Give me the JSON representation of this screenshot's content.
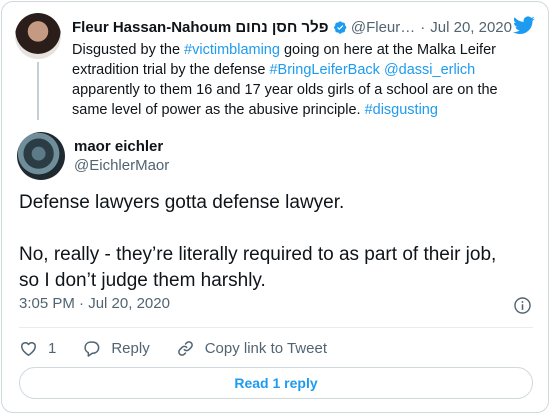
{
  "parent_tweet": {
    "author_name": "Fleur Hassan-Nahoum פלר חסן נחום",
    "handle": "@Fleur…",
    "date": "Jul 20, 2020",
    "text_lines": [
      [
        {
          "t": "Disgusted by the "
        },
        {
          "t": "#victimblaming",
          "link": true
        },
        {
          "t": " going on here at the Malka Leifer"
        }
      ],
      [
        {
          "t": "extradition trial by the defense "
        },
        {
          "t": "#BringLeiferBack",
          "link": true
        },
        {
          "t": " "
        },
        {
          "t": "@dassi_erlich",
          "link": true
        }
      ],
      [
        {
          "t": "apparently to them 16 and 17 year olds girls of a school are on the"
        }
      ],
      [
        {
          "t": "same level of power as the abusive principle. "
        },
        {
          "t": "#disgusting",
          "link": true
        }
      ]
    ]
  },
  "reply_tweet": {
    "author_name": "maor eichler",
    "handle": "@EichlerMaor",
    "text_lines": [
      "Defense lawyers gotta defense lawyer.",
      "",
      "No, really - they’re literally required to as part of their job,",
      "so I don’t judge them harshly."
    ],
    "time": "3:05 PM",
    "date": "Jul 20, 2020"
  },
  "actions": {
    "like_count": "1",
    "reply_label": "Reply",
    "copy_link_label": "Copy link to Tweet"
  },
  "read_replies_label": "Read 1 reply",
  "colors": {
    "link": "#1d9bf0",
    "text": "#0f1419",
    "muted": "#536471",
    "border": "#cfd9de"
  },
  "icons": [
    "verified-badge-icon",
    "twitter-bird-icon",
    "info-icon",
    "heart-icon",
    "reply-bubble-icon",
    "link-icon"
  ]
}
